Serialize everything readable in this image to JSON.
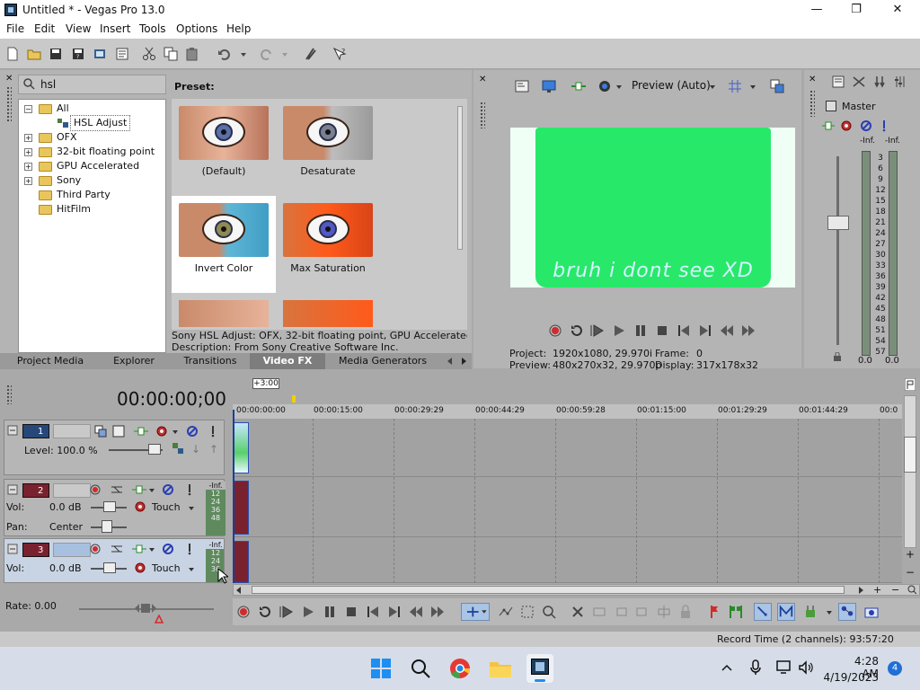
{
  "window": {
    "title": "Untitled * - Vegas Pro 13.0"
  },
  "menu": [
    "File",
    "Edit",
    "View",
    "Insert",
    "Tools",
    "Options",
    "Help"
  ],
  "fx_panel": {
    "search_value": "hsl",
    "tree": [
      {
        "label": "All",
        "expander": "−"
      },
      {
        "label": "HSL Adjust",
        "expander": ""
      },
      {
        "label": "OFX",
        "expander": "+"
      },
      {
        "label": "32-bit floating point",
        "expander": "+"
      },
      {
        "label": "GPU Accelerated",
        "expander": "+"
      },
      {
        "label": "Sony",
        "expander": "+"
      },
      {
        "label": "Third Party",
        "expander": ""
      },
      {
        "label": "HitFilm",
        "expander": ""
      }
    ],
    "preset_heading": "Preset:",
    "presets": [
      "(Default)",
      "Desaturate",
      "Invert Color",
      "Max Saturation"
    ],
    "description_line1": "Sony HSL Adjust: OFX, 32-bit floating point, GPU Accelerated, Group",
    "description_line2": "Description: From Sony Creative Software Inc.",
    "tabs": [
      "Project Media",
      "Explorer",
      "Transitions",
      "Video FX",
      "Media Generators"
    ]
  },
  "preview": {
    "mode": "Preview (Auto)",
    "caption": "bruh i dont see XD",
    "project_label": "Project:",
    "project_value": "1920x1080, 29.970i",
    "frame_label": "Frame:",
    "frame_value": "0",
    "preview_label": "Preview:",
    "preview_value": "480x270x32, 29.970p",
    "display_label": "Display:",
    "display_value": "317x178x32"
  },
  "master": {
    "title": "Master",
    "inf_left": "-Inf.",
    "inf_right": "-Inf.",
    "scale": [
      "3",
      "6",
      "9",
      "12",
      "15",
      "18",
      "21",
      "24",
      "27",
      "30",
      "33",
      "36",
      "39",
      "42",
      "45",
      "48",
      "51",
      "54",
      "57"
    ],
    "value_left": "0.0",
    "value_right": "0.0"
  },
  "timeline": {
    "timecode": "00:00:00;00",
    "marker": "+3:00",
    "ruler": [
      "00:00:00:00",
      "00:00:15:00",
      "00:00:29:29",
      "00:00:44:29",
      "00:00:59:28",
      "00:01:15:00",
      "00:01:29:29",
      "00:01:44:29",
      "00:0"
    ],
    "tracks": [
      {
        "num": "1",
        "level_label": "Level: 100.0 %"
      },
      {
        "num": "2",
        "vol_label": "Vol:",
        "vol_value": "0.0 dB",
        "mode": "Touch",
        "pan_label": "Pan:",
        "pan_value": "Center",
        "meter_top": "-Inf.",
        "meter": [
          "12",
          "24",
          "36",
          "48"
        ]
      },
      {
        "num": "3",
        "vol_label": "Vol:",
        "vol_value": "0.0 dB",
        "mode": "Touch",
        "meter_top": "-Inf.",
        "meter": [
          "12",
          "24",
          "36"
        ]
      }
    ],
    "rate": "Rate: 0.00"
  },
  "status": {
    "record_time": "Record Time (2 channels): 93:57:20"
  },
  "taskbar": {
    "time": "4:28 AM",
    "date": "4/19/2023",
    "notification_count": "4"
  },
  "colors": {
    "accent_green": "#28e86a",
    "video_track": "#26477a",
    "audio_track": "#7a2130",
    "record_red": "#d42a2a"
  }
}
